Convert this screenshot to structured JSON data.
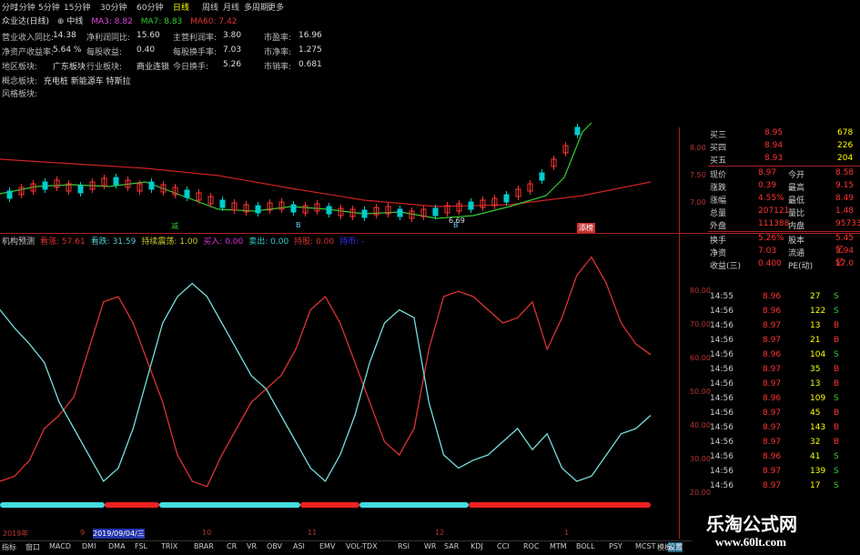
{
  "topbar": {
    "tabs": [
      "分时",
      "1分钟",
      "5分钟",
      "15分钟",
      "30分钟",
      "60分钟",
      "日线",
      "周线",
      "月线",
      "多周期",
      "更多"
    ],
    "active_tab": "日线"
  },
  "header": {
    "stock_name": "众业达(日线)",
    "plus": "中线",
    "ma3": "MA3: 8.82",
    "ma7": "MA7: 8.83",
    "ma60": "MA60: 7.42"
  },
  "info": {
    "rows": [
      [
        [
          "营业收入同比:",
          "14.38"
        ],
        [
          "净利润同比:",
          "15.60"
        ],
        [
          "主营利润率:",
          "3.80"
        ],
        [
          "市盈率:",
          "16.96"
        ]
      ],
      [
        [
          "净资产收益率:",
          "5.64 %"
        ],
        [
          "每股收益:",
          "0.40"
        ],
        [
          "每股换手率:",
          "7.03"
        ],
        [
          "市净率:",
          "1.275"
        ]
      ],
      [
        [
          "地区板块:",
          "广东板块"
        ],
        [
          "行业板块:",
          "商业连锁"
        ],
        [
          "今日换手:",
          "5.26"
        ],
        [
          "市销率:",
          "0.681"
        ]
      ]
    ],
    "concept_label": "概念板块:",
    "concept_value": "充电桩 新能源车 特斯拉",
    "style_label": "风格板块:"
  },
  "main_chart": {
    "axis": [
      "8.00",
      "7.50",
      "7.00"
    ],
    "low_label": "6.69",
    "marks": [
      "减",
      "B",
      "B",
      "添榜"
    ]
  },
  "indicator": {
    "name": "机构预测",
    "items": [
      {
        "label": "看涨: 57.61",
        "color": "#d33"
      },
      {
        "label": "看跌: 31.59",
        "color": "#5cc"
      },
      {
        "label": "持续震荡: 1.00",
        "color": "#cc3"
      },
      {
        "label": "买入: 0.00",
        "color": "#d3d"
      },
      {
        "label": "卖出: 0.00",
        "color": "#3cc"
      },
      {
        "label": "持股: 0.00",
        "color": "#d33"
      },
      {
        "label": "持币: -",
        "color": "#33f"
      }
    ],
    "axis": [
      "80.00",
      "70.00",
      "60.00",
      "50.00",
      "40.00",
      "30.00",
      "20.00"
    ]
  },
  "chart_data": {
    "type": "line",
    "series": [
      {
        "name": "看涨",
        "color": "#d33",
        "values": [
          10,
          12,
          18,
          30,
          35,
          42,
          60,
          78,
          80,
          70,
          55,
          40,
          20,
          10,
          8,
          20,
          30,
          40,
          45,
          50,
          60,
          75,
          80,
          70,
          55,
          40,
          25,
          20,
          30,
          60,
          80,
          82,
          80,
          75,
          70,
          72,
          78,
          60,
          72,
          88,
          95,
          85,
          70,
          62,
          58
        ]
      },
      {
        "name": "看跌",
        "color": "#7dd",
        "values": [
          75,
          68,
          62,
          55,
          40,
          30,
          20,
          10,
          15,
          30,
          50,
          70,
          80,
          85,
          80,
          70,
          60,
          50,
          45,
          35,
          25,
          15,
          10,
          20,
          35,
          55,
          70,
          75,
          72,
          40,
          20,
          15,
          18,
          20,
          25,
          30,
          22,
          28,
          15,
          10,
          12,
          20,
          28,
          30,
          35
        ]
      }
    ]
  },
  "quote": {
    "bids": [
      [
        "买三",
        "8.95",
        "678"
      ],
      [
        "买四",
        "8.94",
        "226"
      ],
      [
        "买五",
        "8.93",
        "204"
      ]
    ],
    "rows": [
      [
        [
          "现价",
          "8.97"
        ],
        [
          "今开",
          "8.58"
        ]
      ],
      [
        [
          "涨跌",
          "0.39"
        ],
        [
          "最高",
          "9.15"
        ]
      ],
      [
        [
          "涨幅",
          "4.55%"
        ],
        [
          "最低",
          "8.49"
        ]
      ],
      [
        [
          "总量",
          "207121"
        ],
        [
          "量比",
          "1.48"
        ]
      ],
      [
        [
          "外盘",
          "111388"
        ],
        [
          "内盘",
          "95733"
        ]
      ]
    ],
    "rows2": [
      [
        [
          "换手",
          "5.26%"
        ],
        [
          "股本",
          "5.45亿"
        ]
      ],
      [
        [
          "净资",
          "7.03"
        ],
        [
          "流通",
          "3.94亿"
        ]
      ],
      [
        [
          "收益(三)",
          "0.400"
        ],
        [
          "PE(动)",
          "17.0"
        ]
      ]
    ]
  },
  "trades": [
    [
      "14:55",
      "8.96",
      "27",
      "S"
    ],
    [
      "14:56",
      "8.96",
      "122",
      "S"
    ],
    [
      "14:56",
      "8.97",
      "13",
      "B"
    ],
    [
      "14:56",
      "8.97",
      "21",
      "B"
    ],
    [
      "14:56",
      "8.96",
      "104",
      "S"
    ],
    [
      "14:56",
      "8.97",
      "35",
      "B"
    ],
    [
      "14:56",
      "8.97",
      "13",
      "B"
    ],
    [
      "14:56",
      "8.96",
      "109",
      "S"
    ],
    [
      "14:56",
      "8.97",
      "45",
      "B"
    ],
    [
      "14:56",
      "8.97",
      "143",
      "B"
    ],
    [
      "14:56",
      "8.97",
      "32",
      "B"
    ],
    [
      "14:56",
      "8.96",
      "41",
      "S"
    ],
    [
      "14:56",
      "8.97",
      "139",
      "S"
    ],
    [
      "14:56",
      "8.97",
      "17",
      "S"
    ]
  ],
  "timebar": {
    "labels": [
      "2019年",
      "9",
      "2019/09/04/三",
      "10",
      "11",
      "12",
      "1"
    ]
  },
  "bottombar": {
    "items": [
      "指标",
      "窗口",
      "MACD",
      "DMI",
      "DMA",
      "FSL",
      "TRIX",
      "BRAR",
      "CR",
      "VR",
      "OBV",
      "ASI",
      "EMV",
      "VOL-TDX",
      "RSI",
      "WR",
      "SAR",
      "KDJ",
      "CCI",
      "ROC",
      "MTM",
      "BOLL",
      "PSY",
      "MCST",
      "设置"
    ],
    "right": "模板"
  },
  "watermark": {
    "title": "乐淘公式网",
    "url": "www.60lt.com"
  },
  "colors": {
    "up": "#ff3333",
    "down": "#00cccc",
    "ma60": "#cc2222",
    "ma7": "#33cc33"
  }
}
